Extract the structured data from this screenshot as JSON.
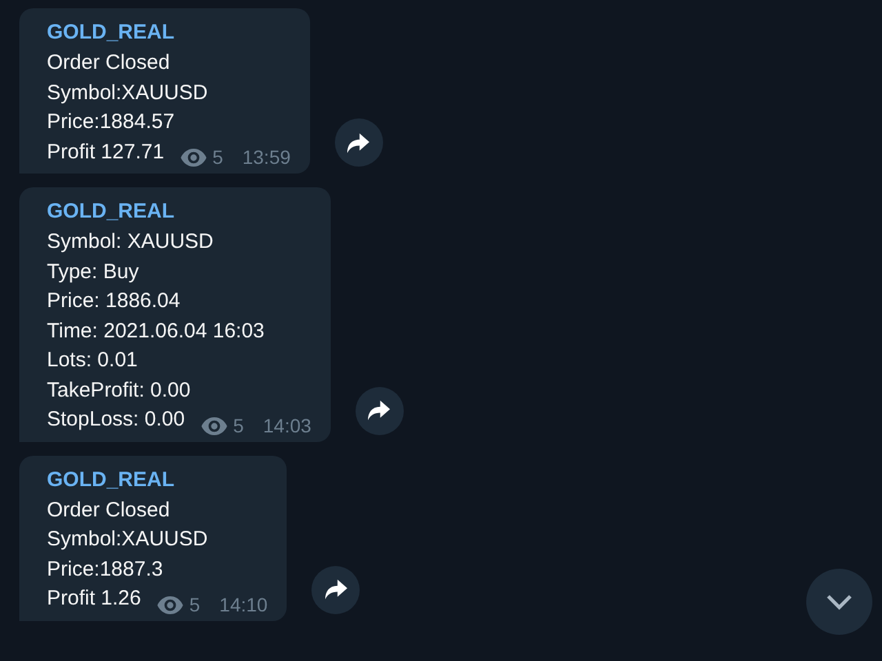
{
  "messages": [
    {
      "author": "GOLD_REAL",
      "lines": [
        "Order Closed",
        "Symbol:XAUUSD",
        "Price:1884.57",
        "Profit 127.71"
      ],
      "views": "5",
      "time": "13:59"
    },
    {
      "author": "GOLD_REAL",
      "lines": [
        "Symbol: XAUUSD",
        "Type: Buy",
        "Price: 1886.04",
        "Time: 2021.06.04 16:03",
        "Lots: 0.01",
        "TakeProfit: 0.00",
        "StopLoss: 0.00"
      ],
      "views": "5",
      "time": "14:03"
    },
    {
      "author": "GOLD_REAL",
      "lines": [
        "Order Closed",
        "Symbol:XAUUSD",
        "Price:1887.3",
        "Profit 1.26"
      ],
      "views": "5",
      "time": "14:10"
    }
  ]
}
